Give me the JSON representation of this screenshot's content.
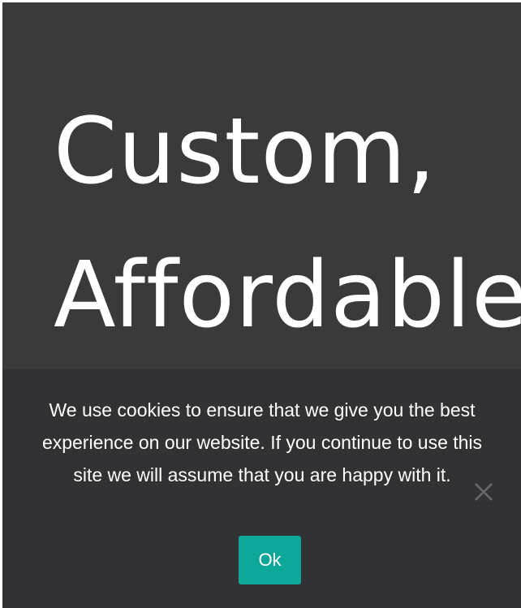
{
  "hero": {
    "line1": "Custom,",
    "line2": "Affordable"
  },
  "cookie_banner": {
    "message": "We use cookies to ensure that we give you the best experience on our website. If you continue to use this site we will assume that you are happy with it.",
    "ok_label": "Ok",
    "close_icon": "close-icon"
  },
  "colors": {
    "page_background": "#3a3a3b",
    "banner_background": "#323235",
    "accent": "#0ea89a",
    "text": "#ffffff"
  }
}
